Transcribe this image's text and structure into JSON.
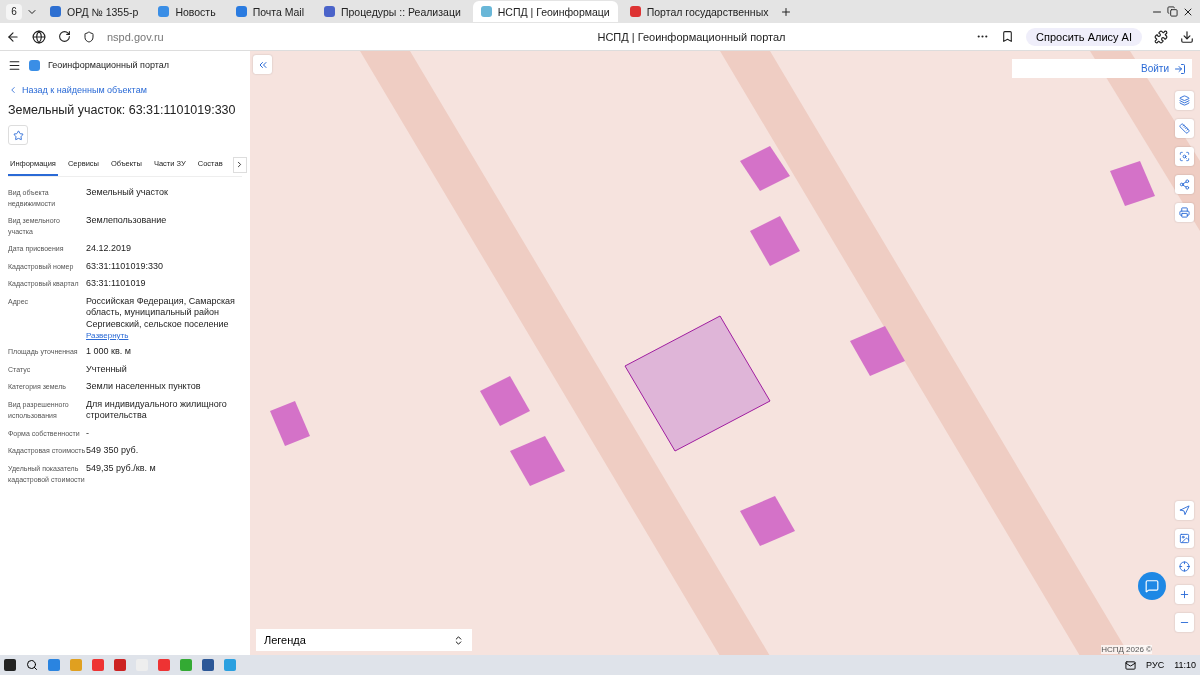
{
  "browser": {
    "tab_count": "6",
    "tabs": [
      {
        "title": "ОРД № 1355-р",
        "selected": false
      },
      {
        "title": "Новость",
        "selected": false
      },
      {
        "title": "Почта Mail",
        "selected": false
      },
      {
        "title": "Процедуры :: Реализаци",
        "selected": false
      },
      {
        "title": "НСПД | Геоинформаци",
        "selected": true
      },
      {
        "title": "Портал государственных",
        "selected": false
      }
    ],
    "address": "nspd.gov.ru",
    "page_title": "НСПД | Геоинформационный портал",
    "assistant_button": "Спросить Алису AI"
  },
  "panel": {
    "app_title": "Геоинформационный портал",
    "back_link": "Назад к найденным объектам",
    "heading": "Земельный участок: 63:31:1101019:330",
    "tabs": [
      {
        "label": "Информация",
        "selected": true
      },
      {
        "label": "Сервисы",
        "selected": false
      },
      {
        "label": "Объекты",
        "selected": false
      },
      {
        "label": "Части ЗУ",
        "selected": false
      },
      {
        "label": "Состав",
        "selected": false
      }
    ],
    "fields": [
      {
        "label": "Вид объекта недвижимости",
        "value": "Земельный участок"
      },
      {
        "label": "Вид земельного участка",
        "value": "Землепользование"
      },
      {
        "label": "Дата присвоения",
        "value": "24.12.2019"
      },
      {
        "label": "Кадастровый номер",
        "value": "63:31:1101019:330"
      },
      {
        "label": "Кадастровый квартал",
        "value": "63:31:1101019"
      },
      {
        "label": "Адрес",
        "value": "Российская Федерация, Самарская область, муниципальный район Сергиевский, сельское поселение",
        "expand_link": "Развернуть"
      },
      {
        "label": "Площадь уточненная",
        "value": "1 000 кв. м"
      },
      {
        "label": "Статус",
        "value": "Учтенный"
      },
      {
        "label": "Категория земель",
        "value": "Земли населенных пунктов"
      },
      {
        "label": "Вид разрешенного использования",
        "value": "Для индивидуального жилищного строительства"
      },
      {
        "label": "Форма собственности",
        "value": "-"
      },
      {
        "label": "Кадастровая стоимость",
        "value": "549 350 руб."
      },
      {
        "label": "Удельный показатель кадастровой стоимости",
        "value": "549,35 руб./кв. м"
      }
    ]
  },
  "map": {
    "login_button": "Войти",
    "legend": "Легенда",
    "attribution": "НСПД 2026 ©"
  },
  "taskbar": {
    "language": "РУС",
    "time": "11:10"
  }
}
